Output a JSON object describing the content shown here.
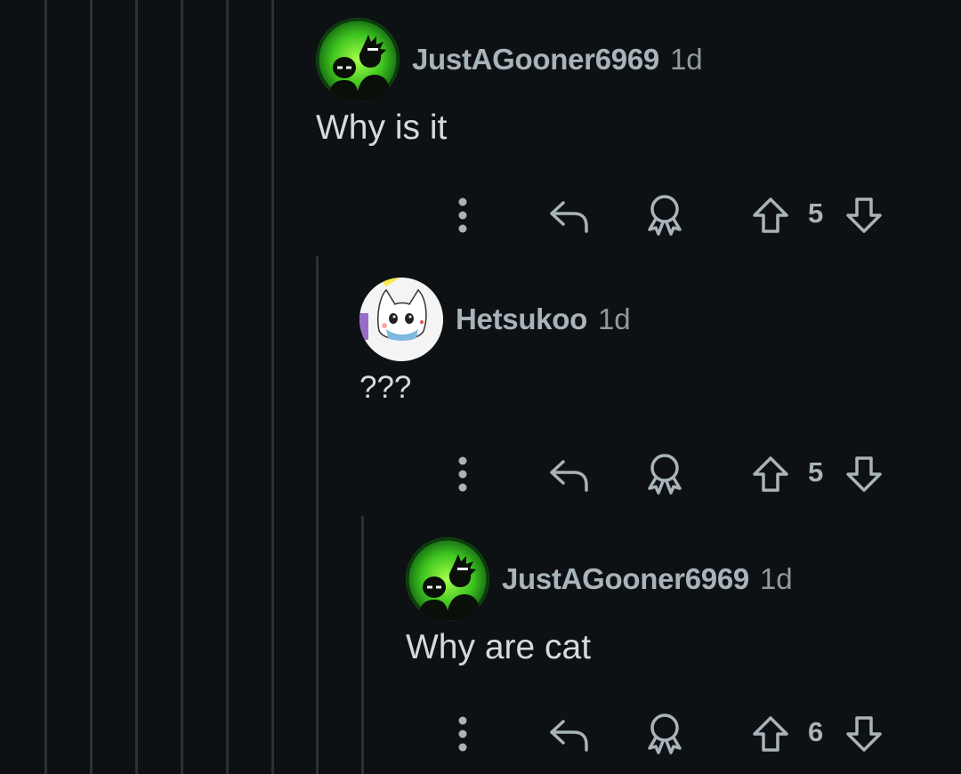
{
  "comments": [
    {
      "username": "JustAGooner6969",
      "time": "1d",
      "body": "Why is it",
      "votes": "5",
      "avatar": "rick-morty-avatar"
    },
    {
      "username": "Hetsukoo",
      "time": "1d",
      "body": "???",
      "votes": "5",
      "avatar": "white-cat-avatar"
    },
    {
      "username": "JustAGooner6969",
      "time": "1d",
      "body": "Why are cat",
      "votes": "6",
      "avatar": "rick-morty-avatar"
    }
  ],
  "icons": {
    "more": "more-vertical-icon",
    "reply": "reply-icon",
    "award": "award-icon",
    "upvote": "upvote-arrow-icon",
    "downvote": "downvote-arrow-icon"
  },
  "colors": {
    "background": "#0e1113",
    "thread_line": "#2a3236",
    "username": "#a8b3ba",
    "text": "#d7dadc",
    "avatar_green": "#3ec51f"
  }
}
